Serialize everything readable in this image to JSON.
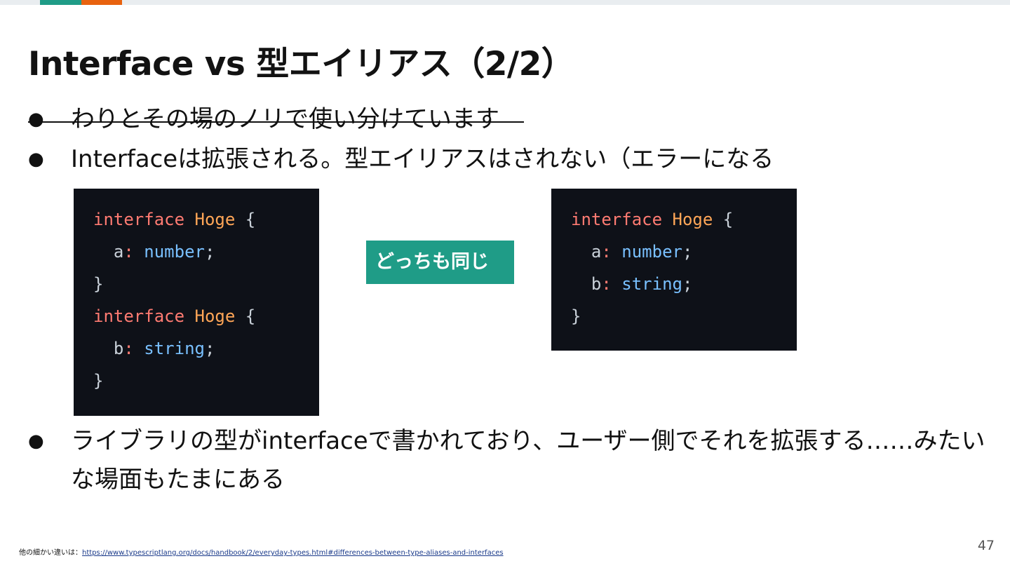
{
  "title": "Interface vs 型エイリアス（2/2）",
  "bullets": [
    {
      "dot": "●",
      "text": "わりとその場のノリで使い分けています",
      "strikethrough": true
    },
    {
      "dot": "●",
      "text": "Interfaceは拡張される。型エイリアスはされない（エラーになる"
    },
    {
      "dot": "●",
      "text": "ライブラリの型がinterfaceで書かれており、ユーザー側でそれを拡張する……みたいな場面もたまにある"
    }
  ],
  "code_left": {
    "lines": [
      {
        "kw": "interface",
        "name": "Hoge",
        "rest": "{"
      },
      {
        "prop": "a",
        "colon": ":",
        "type": "number",
        "end": ";"
      },
      {
        "close": "}"
      },
      {
        "kw": "interface",
        "name": "Hoge",
        "rest": "{"
      },
      {
        "prop": "b",
        "colon": ":",
        "type": "string",
        "end": ";"
      },
      {
        "close": "}"
      }
    ]
  },
  "code_right": {
    "lines": [
      {
        "kw": "interface",
        "name": "Hoge",
        "rest": "{"
      },
      {
        "prop": "a",
        "colon": ":",
        "type": "number",
        "end": ";"
      },
      {
        "prop": "b",
        "colon": ":",
        "type": "string",
        "end": ";"
      },
      {
        "close": "}"
      }
    ]
  },
  "same_label": "どっちも同じ",
  "footer": {
    "prefix": "他の細かい違いは：",
    "link_text": "https://www.typescriptlang.org/docs/handbook/2/everyday-types.html#differences-between-type-aliases-and-interfaces"
  },
  "page_number": "47",
  "colors": {
    "accent_teal": "#1f9c87",
    "accent_orange": "#e8620f",
    "code_bg": "#0e1118"
  }
}
